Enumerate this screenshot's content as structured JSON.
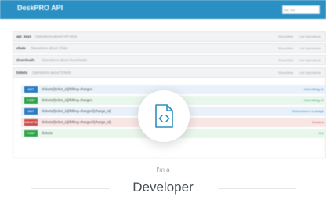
{
  "app": {
    "title": "DeskPRO API"
  },
  "search": {
    "placeholder": "api_key"
  },
  "sections": [
    {
      "name": "api_keys",
      "desc": "Operations about API keys",
      "actions": [
        "Show/Hide",
        "List Operations"
      ]
    },
    {
      "name": "chats",
      "desc": "Operations about Chats",
      "actions": [
        "Show/Hide",
        "List Operations"
      ]
    },
    {
      "name": "downloads",
      "desc": "Operations about Downloads",
      "actions": [
        "Show/Hide",
        "List Operations"
      ]
    },
    {
      "name": "tickets",
      "desc": "Operations about Tickets",
      "actions": [
        "Show/Hide",
        "List Operations"
      ]
    }
  ],
  "operations": [
    {
      "verb": "GET",
      "color": "#2c7bc0",
      "bg": "#e8f1f9",
      "path": "/tickets/{ticket_id}/billing-charges",
      "summary": "Gets billing ch"
    },
    {
      "verb": "POST",
      "color": "#2fa24a",
      "bg": "#e9f6ec",
      "path": "/tickets/{ticket_id}/billing-charges",
      "summary": "Gets billing ch"
    },
    {
      "verb": "GET",
      "color": "#2c7bc0",
      "bg": "#e8f1f9",
      "path": "/tickets/{ticket_id}/billing-charges/{charge_id}",
      "summary": "Determines if a charge"
    },
    {
      "verb": "DELETE",
      "color": "#c94a48",
      "bg": "#f8e6e5",
      "path": "/tickets/{ticket_id}/billing-charges/{charge_id}",
      "summary": "Delete a"
    },
    {
      "verb": "POST",
      "color": "#2fa24a",
      "bg": "#e9f6ec",
      "path": "/tickets",
      "summary": "Cre"
    }
  ],
  "badge": {
    "icon": "code-file-icon",
    "accent": "#2a8fc3"
  },
  "hero": {
    "intro": "I'm a",
    "role": "Developer"
  }
}
